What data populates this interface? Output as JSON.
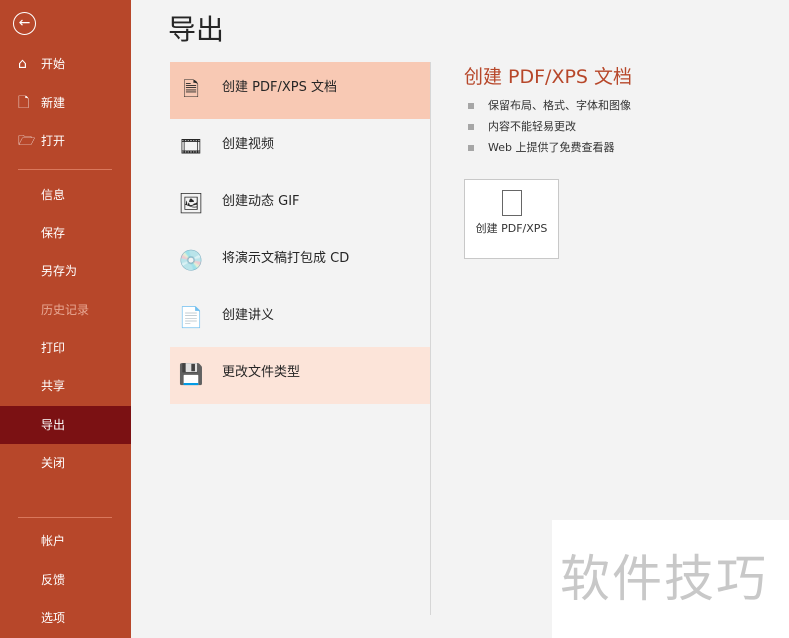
{
  "sidebar": {
    "items": [
      {
        "label": "开始",
        "icon": "home-icon"
      },
      {
        "label": "新建",
        "icon": "new-file-icon"
      },
      {
        "label": "打开",
        "icon": "folder-open-icon"
      },
      {
        "label": "信息"
      },
      {
        "label": "保存"
      },
      {
        "label": "另存为"
      },
      {
        "label": "历史记录"
      },
      {
        "label": "打印"
      },
      {
        "label": "共享"
      },
      {
        "label": "导出"
      },
      {
        "label": "关闭"
      },
      {
        "label": "帐户"
      },
      {
        "label": "反馈"
      },
      {
        "label": "选项"
      }
    ]
  },
  "page_title": "导出",
  "export_options": [
    {
      "label": "创建 PDF/XPS 文档"
    },
    {
      "label": "创建视频"
    },
    {
      "label": "创建动态 GIF"
    },
    {
      "label": "将演示文稿打包成 CD"
    },
    {
      "label": "创建讲义"
    },
    {
      "label": "更改文件类型"
    }
  ],
  "detail": {
    "title": "创建 PDF/XPS 文档",
    "bullets": [
      "保留布局、格式、字体和图像",
      "内容不能轻易更改",
      "Web 上提供了免费查看器"
    ],
    "button_label": "创建 PDF/XPS"
  },
  "watermark": "软件技巧",
  "colors": {
    "sidebar": "#b7472a",
    "selected": "#7b1113",
    "accent": "#b7472a"
  }
}
